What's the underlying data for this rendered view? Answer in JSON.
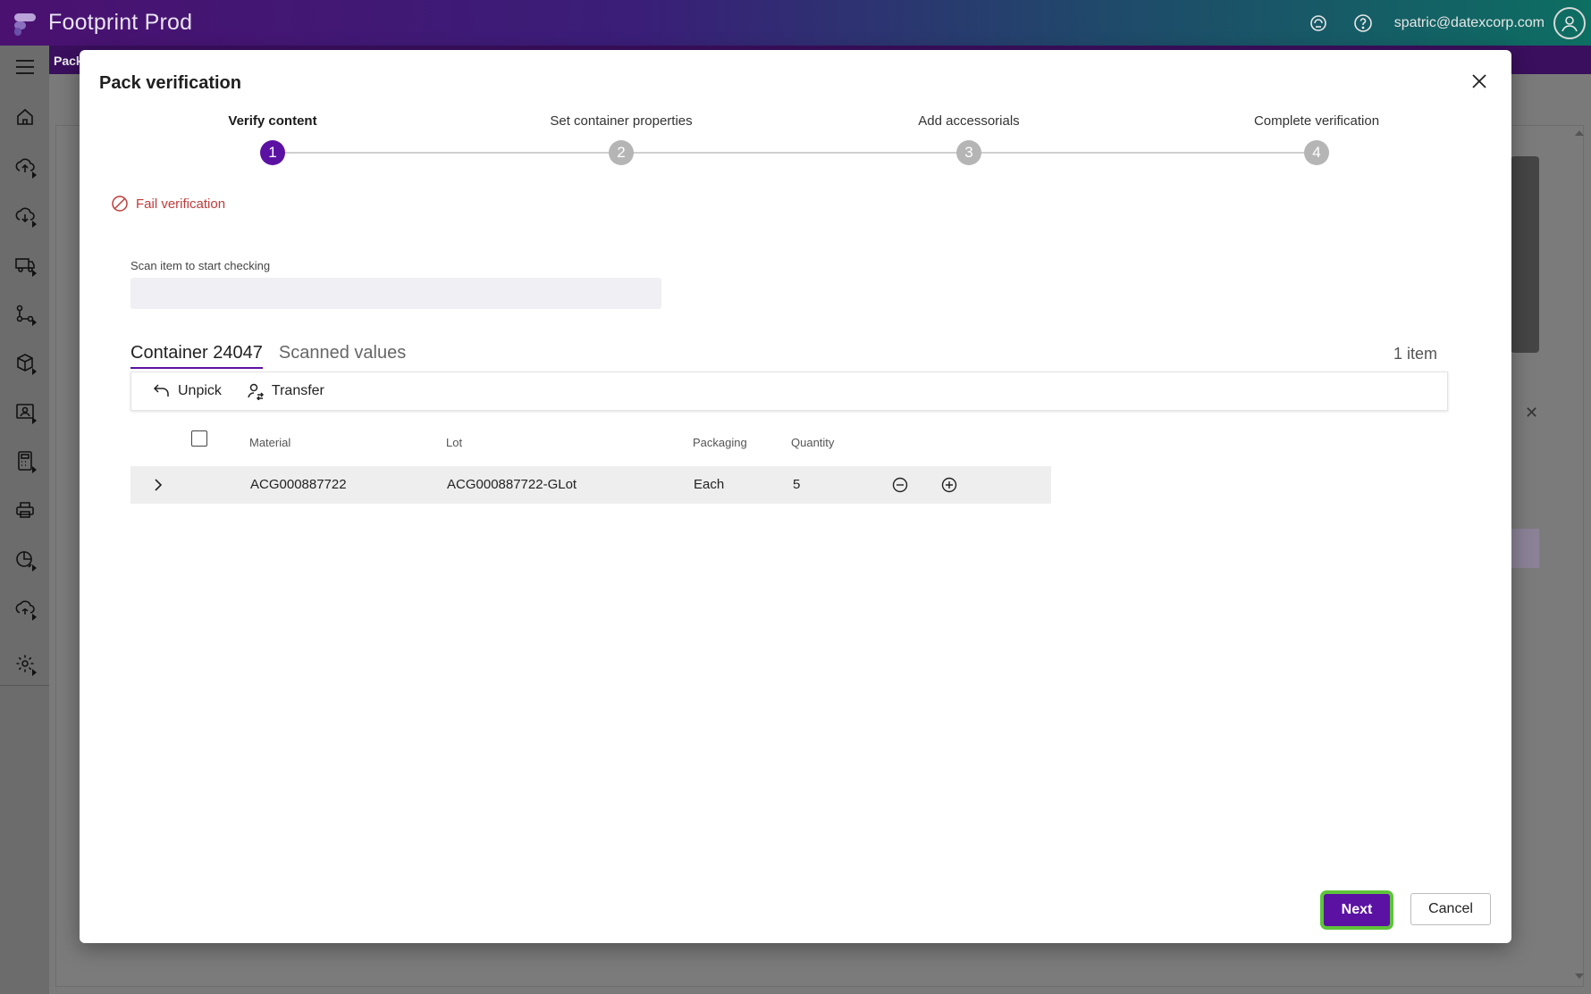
{
  "app": {
    "title": "Footprint Prod",
    "user_email": "spatric@datexcorp.com"
  },
  "background": {
    "subbar_tab": "Pack"
  },
  "rail": {
    "items": [
      {
        "icon": "menu-icon"
      },
      {
        "icon": "home-icon"
      },
      {
        "icon": "inbound-icon"
      },
      {
        "icon": "outbound-icon"
      },
      {
        "icon": "truck-icon"
      },
      {
        "icon": "workflow-icon"
      },
      {
        "icon": "box-icon"
      },
      {
        "icon": "contact-icon"
      },
      {
        "icon": "calculator-icon"
      },
      {
        "icon": "printer-icon"
      },
      {
        "icon": "reports-icon"
      },
      {
        "icon": "cloud-sync-icon"
      },
      {
        "icon": "settings-icon"
      }
    ]
  },
  "modal": {
    "title": "Pack verification",
    "steps": [
      {
        "label": "Verify content",
        "number": "1"
      },
      {
        "label": "Set container properties",
        "number": "2"
      },
      {
        "label": "Add accessorials",
        "number": "3"
      },
      {
        "label": "Complete verification",
        "number": "4"
      }
    ],
    "fail_label": "Fail verification",
    "scan": {
      "label": "Scan item to start checking",
      "value": ""
    },
    "tabs": [
      {
        "label": "Container 24047"
      },
      {
        "label": "Scanned values"
      }
    ],
    "item_count": "1 item",
    "toolbar": {
      "unpick_label": "Unpick",
      "transfer_label": "Transfer"
    },
    "grid": {
      "headers": {
        "material": "Material",
        "lot": "Lot",
        "packaging": "Packaging",
        "quantity": "Quantity"
      },
      "rows": [
        {
          "material": "ACG000887722",
          "lot": "ACG000887722-GLot",
          "packaging": "Each",
          "quantity": "5"
        }
      ]
    },
    "buttons": {
      "next_label": "Next",
      "cancel_label": "Cancel"
    }
  },
  "colors": {
    "accent": "#5b12a3",
    "danger": "#c13b3b",
    "focus_ring": "#5ec43a"
  }
}
